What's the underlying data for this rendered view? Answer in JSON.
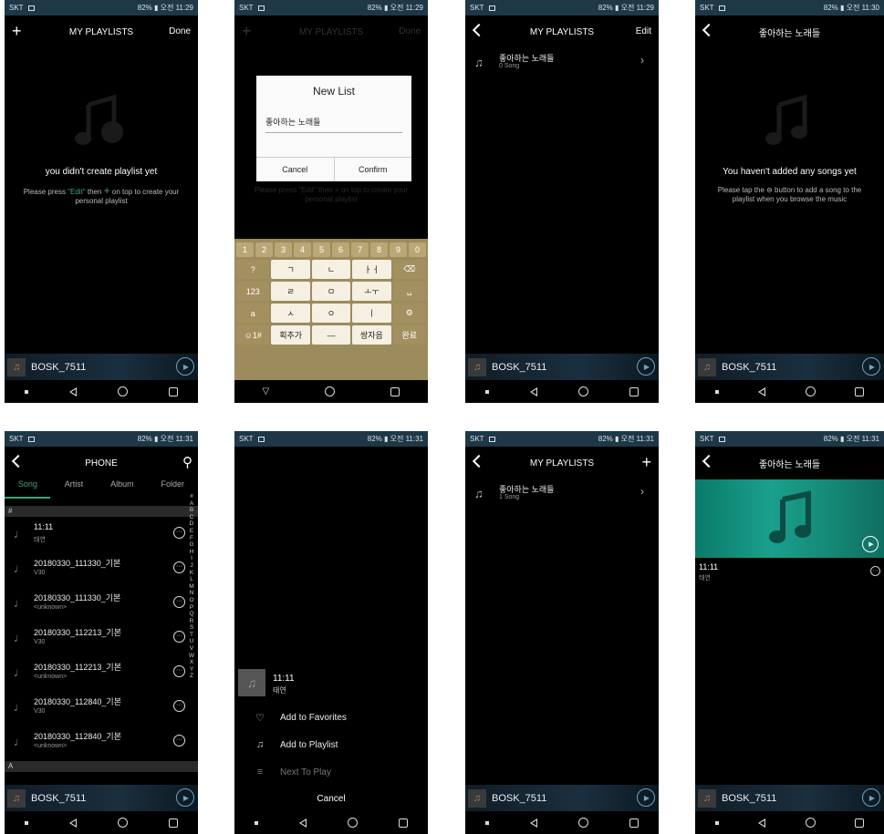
{
  "status": {
    "carrier": "SKT",
    "right_text": "⠀82% ▮ 오전 11:29",
    "right_text_late": "⠀82% ▮ 오전 11:31",
    "right_text_s4": "⠀82% ▮ 오전 11:30"
  },
  "mini_player": {
    "title": "BOSK_7511"
  },
  "s1": {
    "title": "MY PLAYLISTS",
    "right": "Done",
    "left_icon": "+",
    "empty_title": "you didn't create playlist yet",
    "empty_sub_a": "Please press ",
    "empty_sub_edit": "\"Edit\"",
    "empty_sub_b": " then ",
    "empty_sub_plus": "+",
    "empty_sub_c": " on top to create your personal playlist"
  },
  "s2": {
    "title": "MY PLAYLISTS",
    "right": "Done",
    "left_icon": "+",
    "dialog_title": "New List",
    "input_value": "좋아하는 노래들",
    "cancel": "Cancel",
    "confirm": "Confirm",
    "bg_hint": "Please press \"Edit\" then + on top to create your personal playlist",
    "num_keys": [
      "1",
      "2",
      "3",
      "4",
      "5",
      "6",
      "7",
      "8",
      "9",
      "0"
    ],
    "row1": [
      "?",
      "ㄱ",
      "ㄴ",
      "ㅏㅓ",
      "⌫"
    ],
    "row2": [
      "123",
      "ㄹ",
      "ㅁ",
      "ㅗㅜ",
      "␣"
    ],
    "row3": [
      "a",
      "ㅅ",
      "ㅇ",
      "ㅣ",
      "⚙"
    ],
    "row4": [
      "☺1#",
      "획추가",
      "—",
      "쌍자음",
      "완료"
    ]
  },
  "s3": {
    "title": "MY PLAYLISTS",
    "right": "Edit",
    "playlist_name": "좋아하는 노래들",
    "playlist_count": "0 Song"
  },
  "s4": {
    "title": "좋아하는 노래들",
    "empty_title": "You haven't added any songs yet",
    "empty_sub": "Please tap the ⊖ button to add a song to the playlist when you browse the music"
  },
  "s5": {
    "title": "PHONE",
    "tabs": [
      "Song",
      "Artist",
      "Album",
      "Folder"
    ],
    "hash_header": "#",
    "a_header": "A",
    "songs": [
      {
        "name": "11:11",
        "artist": "태연"
      },
      {
        "name": "20180330_111330_기본",
        "artist": "V30"
      },
      {
        "name": "20180330_111330_기본",
        "artist": "<unknown>"
      },
      {
        "name": "20180330_112213_기본",
        "artist": "V30"
      },
      {
        "name": "20180330_112213_기본",
        "artist": "<unknown>"
      },
      {
        "name": "20180330_112840_기본",
        "artist": "V30"
      },
      {
        "name": "20180330_112840_기본",
        "artist": "<unknown>"
      }
    ],
    "alphabet": "#ABCDEFGHIJKLMNOPQRSTUVWXYZ"
  },
  "s6": {
    "song_title": "11:11",
    "song_artist": "태연",
    "menu": [
      {
        "label": "Add to Favorites",
        "icon": "heart-icon"
      },
      {
        "label": "Add to Playlist",
        "icon": "playlist-add-icon"
      },
      {
        "label": "Next To Play",
        "icon": "queue-icon"
      }
    ],
    "cancel": "Cancel"
  },
  "s7": {
    "title": "MY PLAYLISTS",
    "right_icon": "+",
    "playlist_name": "좋아하는 노래들",
    "playlist_count": "1 Song"
  },
  "s8": {
    "title": "좋아하는 노래들",
    "song_title": "11:11",
    "song_artist": "태연"
  }
}
